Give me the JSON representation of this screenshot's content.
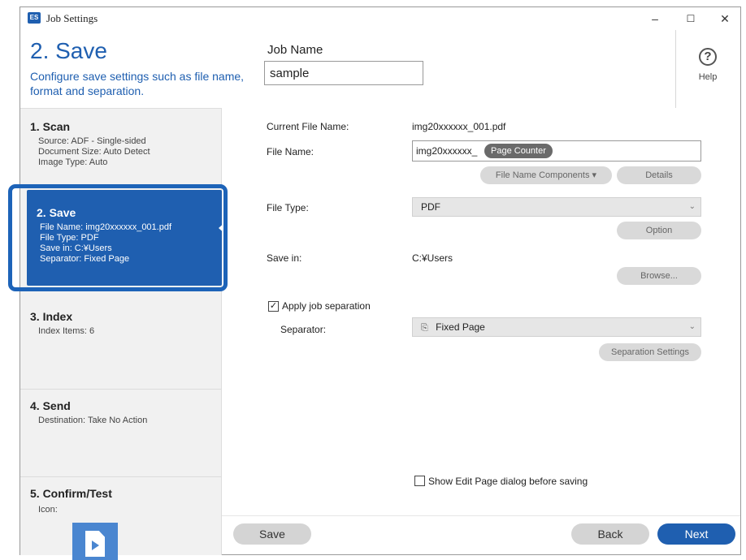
{
  "window": {
    "title": "Job Settings",
    "app_icon_text": "ES",
    "minimize": "–",
    "maximize": "☐",
    "close": "✕"
  },
  "header": {
    "step_title": "2. Save",
    "step_description": "Configure save settings such as file name, format and separation.",
    "job_name_label": "Job Name",
    "job_name_value": "sample",
    "help_label": "Help",
    "help_glyph": "?"
  },
  "sidebar": {
    "scan": {
      "title": "1. Scan",
      "lines": [
        "Source: ADF - Single-sided",
        "Document Size: Auto Detect",
        "Image Type: Auto"
      ]
    },
    "save": {
      "title": "2. Save",
      "lines": [
        "File Name: img20xxxxxx_001.pdf",
        "File Type: PDF",
        "Save in: C:¥Users",
        "Separator: Fixed Page"
      ]
    },
    "index": {
      "title": "3. Index",
      "lines": [
        "Index Items: 6"
      ]
    },
    "send": {
      "title": "4. Send",
      "lines": [
        "Destination: Take No Action"
      ]
    },
    "confirm": {
      "title": "5. Confirm/Test",
      "icon_label": "Icon:"
    }
  },
  "form": {
    "current_file_name_label": "Current File Name:",
    "current_file_name_value": "img20xxxxxx_001.pdf",
    "file_name_label": "File Name:",
    "file_name_prefix": "img20xxxxxx_",
    "file_name_token": "Page Counter",
    "file_name_components_button": "File Name Components ▾",
    "details_button": "Details",
    "file_type_label": "File Type:",
    "file_type_value": "PDF",
    "option_button": "Option",
    "save_in_label": "Save in:",
    "save_in_value": "C:¥Users",
    "browse_button": "Browse...",
    "apply_separation_label": "Apply job separation",
    "apply_separation_checked": "✓",
    "separator_label": "Separator:",
    "separator_value": "Fixed Page",
    "separator_icon": "⎘",
    "separation_settings_button": "Separation Settings",
    "show_edit_page_label": "Show Edit Page dialog before saving",
    "select_chevron": "⌄"
  },
  "footer": {
    "save_button": "Save",
    "back_button": "Back",
    "next_button": "Next"
  },
  "colors": {
    "accent": "#1f5fb0",
    "next_button": "#1f5fb0",
    "button_gray": "#d9d9d9"
  }
}
